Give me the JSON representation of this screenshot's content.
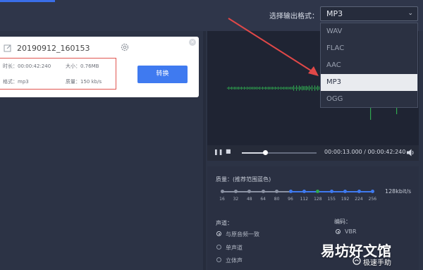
{
  "header": {
    "format_label": "选择输出格式：",
    "format_selected": "MP3",
    "format_options": [
      "WAV",
      "FLAC",
      "AAC",
      "MP3",
      "OGG"
    ]
  },
  "file": {
    "name": "20190912_160153",
    "duration": "时长：00:00:42:240",
    "size": "大小：0.76MB",
    "format": "格式：mp3",
    "quality": "质量：150 kb/s",
    "convert_label": "转换"
  },
  "player": {
    "time": "00:00:13.000 / 00:00:42:240",
    "progress": 0.31
  },
  "settings": {
    "quality_label": "质量：(推荐范围蓝色)",
    "quality_value": "128kbit/s",
    "ticks": [
      "16",
      "32",
      "48",
      "64",
      "80",
      "96",
      "112",
      "128",
      "155",
      "192",
      "224",
      "256"
    ],
    "selected_tick": "128",
    "channel_label": "声道：",
    "channel_options": [
      "与原音频一致",
      "单声道",
      "立体声"
    ],
    "channel_selected": "与原音频一致",
    "encoding_label": "编码：",
    "encoding_option": "VBR"
  },
  "watermark": {
    "title": "易坊好文馆",
    "sub": "极速手助"
  },
  "colors": {
    "accent": "#3f7af0",
    "highlight_box": "#e05550",
    "wave": "#2fa84f",
    "arrow": "#e04848"
  }
}
